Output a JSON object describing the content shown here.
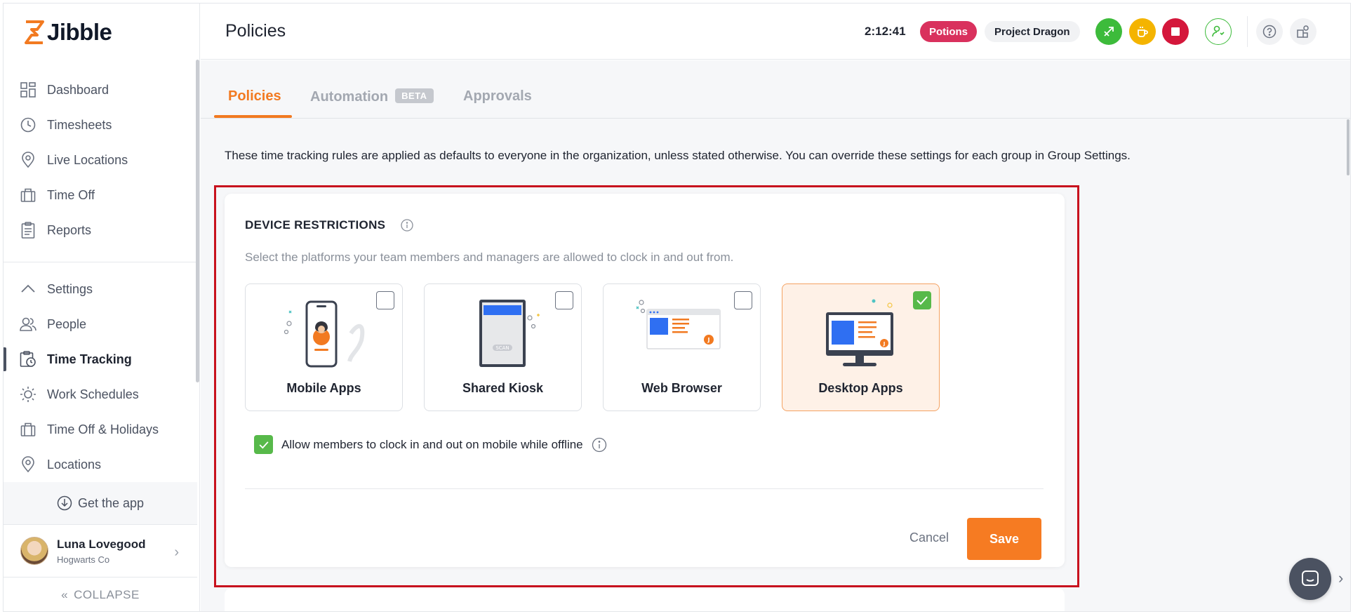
{
  "app": {
    "name": "Jibble"
  },
  "sidebar": {
    "items": [
      {
        "label": "Dashboard",
        "icon": "dashboard-icon"
      },
      {
        "label": "Timesheets",
        "icon": "clock-icon"
      },
      {
        "label": "Live Locations",
        "icon": "location-pin-icon"
      },
      {
        "label": "Time Off",
        "icon": "suitcase-icon"
      },
      {
        "label": "Reports",
        "icon": "clipboard-icon"
      }
    ],
    "settings_items": [
      {
        "label": "Settings",
        "icon": "chevron-up-icon"
      },
      {
        "label": "People",
        "icon": "people-icon"
      },
      {
        "label": "Time Tracking",
        "icon": "time-tracking-icon"
      },
      {
        "label": "Work Schedules",
        "icon": "sun-icon"
      },
      {
        "label": "Time Off & Holidays",
        "icon": "suitcase-icon"
      },
      {
        "label": "Locations",
        "icon": "location-pin-icon"
      }
    ],
    "active_item": "Time Tracking",
    "get_app": "Get the app",
    "user": {
      "name": "Luna Lovegood",
      "org": "Hogwarts Co"
    },
    "collapse": "COLLAPSE"
  },
  "header": {
    "title": "Policies",
    "timer": "2:12:41",
    "activity": "Potions",
    "project": "Project Dragon",
    "colors": {
      "activity": "#d9315d",
      "start": "#3dbb3b",
      "break": "#f4b400",
      "stop": "#d4173b"
    }
  },
  "tabs": [
    {
      "label": "Policies",
      "active": true
    },
    {
      "label": "Automation",
      "badge": "BETA"
    },
    {
      "label": "Approvals"
    }
  ],
  "intro_text": "These time tracking rules are applied as defaults to everyone in the organization, unless stated otherwise. You can override these settings for each group in Group Settings.",
  "device_restrictions": {
    "title": "DEVICE RESTRICTIONS",
    "description": "Select the platforms your team members and managers are allowed to clock in and out from.",
    "platforms": [
      {
        "label": "Mobile Apps",
        "checked": false
      },
      {
        "label": "Shared Kiosk",
        "checked": false
      },
      {
        "label": "Web Browser",
        "checked": false
      },
      {
        "label": "Desktop Apps",
        "checked": true
      }
    ],
    "kiosk_screen_text": "SCAN",
    "offline_option": {
      "label": "Allow members to clock in and out on mobile while offline",
      "checked": true
    },
    "cancel": "Cancel",
    "save": "Save",
    "accent": "#f67b22"
  }
}
